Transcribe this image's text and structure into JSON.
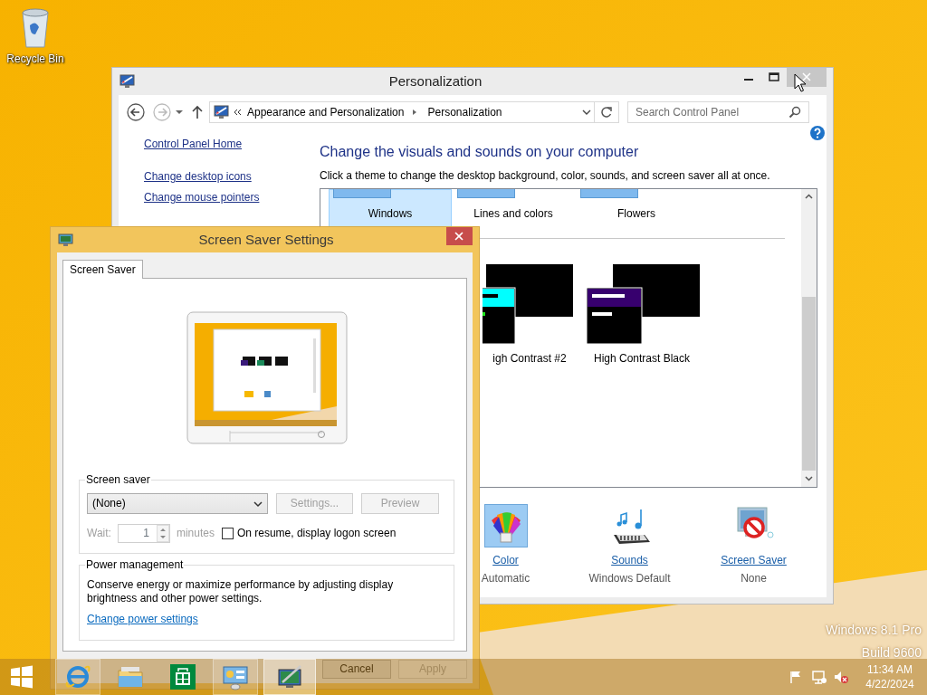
{
  "desktop": {
    "icons": [
      {
        "label": "Recycle Bin"
      }
    ],
    "edition": [
      "Windows 8.1 Pro",
      "Build 9600"
    ]
  },
  "personalization": {
    "title": "Personalization",
    "address": {
      "crumbs": [
        "Appearance and Personalization",
        "Personalization"
      ]
    },
    "search": {
      "placeholder": "Search Control Panel"
    },
    "sidebar": [
      "Control Panel Home",
      "Change desktop icons",
      "Change mouse pointers"
    ],
    "heading": "Change the visuals and sounds on your computer",
    "intro": "Click a theme to change the desktop background, color, sounds, and screen saver all at once.",
    "my_themes": [
      {
        "label": "Windows",
        "selected": true
      },
      {
        "label": "Lines and colors",
        "selected": false
      },
      {
        "label": "Flowers",
        "selected": false
      }
    ],
    "high_contrast_themes": [
      {
        "label": "igh Contrast #2",
        "color": "#00ffff",
        "selected": false
      },
      {
        "label": "High Contrast Black",
        "color": "#37006e",
        "selected": false
      }
    ],
    "settings": [
      {
        "kind": "color",
        "label": "Color",
        "value": "Automatic",
        "selected": true
      },
      {
        "kind": "sounds",
        "label": "Sounds",
        "value": "Windows Default",
        "selected": false
      },
      {
        "kind": "screensaver",
        "label": "Screen Saver",
        "value": "None",
        "selected": false
      }
    ]
  },
  "screen_saver_dialog": {
    "title": "Screen Saver Settings",
    "tabs": [
      {
        "label": "Screen Saver",
        "selected": true
      }
    ],
    "screen_saver": {
      "legend": "Screen saver",
      "select": "(None)",
      "buttons": [
        {
          "label": "Settings...",
          "disabled": true
        },
        {
          "label": "Preview",
          "disabled": true
        }
      ],
      "wait_label": "Wait:",
      "wait_value": "1",
      "minutes_label": "minutes",
      "wait_disabled": true,
      "logon": {
        "label": "On resume, display logon screen",
        "checked": false
      }
    },
    "power": {
      "legend": "Power management",
      "text": "Conserve energy or maximize performance by adjusting display brightness and other power settings.",
      "link": "Change power settings"
    },
    "buttons": [
      {
        "label": "Cancel",
        "disabled": false
      },
      {
        "label": "Apply",
        "disabled": true
      }
    ]
  },
  "taskbar": {
    "apps": [
      {
        "kind": "ie",
        "running": true,
        "selected": false
      },
      {
        "kind": "explorer",
        "running": false,
        "selected": false
      },
      {
        "kind": "store",
        "running": false,
        "selected": false
      },
      {
        "kind": "controlpanel",
        "running": true,
        "selected": false
      },
      {
        "kind": "personalization",
        "running": true,
        "selected": true
      }
    ],
    "time": "11:34 AM",
    "date": "4/22/2024"
  }
}
